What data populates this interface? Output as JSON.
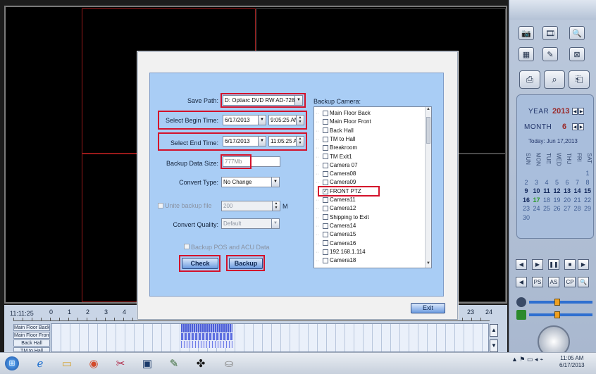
{
  "timeline": {
    "current_time": "11:11:25",
    "ticks_left": [
      "0",
      "1",
      "2",
      "3",
      "4"
    ],
    "ticks_right": [
      "23",
      "24"
    ],
    "channels": [
      "Main Floor Back",
      "Main Floor Front",
      "Back Hall",
      "TM to Hall"
    ]
  },
  "calendar": {
    "year_label": "YEAR",
    "year": "2013",
    "month_label": "MONTH",
    "month": "6",
    "today": "Today: Jun 17,2013",
    "day_names": [
      "SUN",
      "MON",
      "TUE",
      "WED",
      "THU",
      "FRI",
      "SAT"
    ],
    "days": [
      [
        "",
        "",
        "",
        "",
        "",
        "",
        "1"
      ],
      [
        "2",
        "3",
        "4",
        "5",
        "6",
        "7",
        "8"
      ],
      [
        "9",
        "10",
        "11",
        "12",
        "13",
        "14",
        "15"
      ],
      [
        "16",
        "17",
        "18",
        "19",
        "20",
        "21",
        "22"
      ],
      [
        "23",
        "24",
        "25",
        "26",
        "27",
        "28",
        "29"
      ],
      [
        "30",
        "",
        "",
        "",
        "",
        "",
        ""
      ]
    ]
  },
  "controls": {
    "row2_labels": [
      "PS",
      "AS",
      "CP"
    ]
  },
  "dialog": {
    "save_path_label": "Save Path:",
    "save_path_value": "D: Optiarc DVD RW AD-728",
    "begin_label": "Select Begin Time:",
    "begin_date": "6/17/2013",
    "begin_time": "9:05:25 AM",
    "end_label": "Select End Time:",
    "end_date": "6/17/2013",
    "end_time": "11:05:25 AM",
    "size_label": "Backup Data Size:",
    "size_value": "777Mb",
    "convert_type_label": "Convert Type:",
    "convert_type_value": "No Change",
    "unite_label": "Unite backup file",
    "unite_value": "200",
    "unite_unit": "M",
    "convert_quality_label": "Convert Quality:",
    "convert_quality_value": "Default",
    "pos_label": "Backup POS and ACU Data",
    "check_button": "Check",
    "backup_button": "Backup",
    "exit_button": "Exit",
    "camera_label": "Backup Camera:",
    "cameras": [
      {
        "name": "Main Floor Back",
        "checked": false
      },
      {
        "name": "Main Floor Front",
        "checked": false
      },
      {
        "name": "Back Hall",
        "checked": false
      },
      {
        "name": "TM to Hall",
        "checked": false
      },
      {
        "name": "Breakroom",
        "checked": false
      },
      {
        "name": "TM Exit1",
        "checked": false
      },
      {
        "name": "Camera 07",
        "checked": false
      },
      {
        "name": "Camera08",
        "checked": false
      },
      {
        "name": "Camera09",
        "checked": false
      },
      {
        "name": "FRONT PTZ",
        "checked": true
      },
      {
        "name": "Camera11",
        "checked": false
      },
      {
        "name": "Camera12",
        "checked": false
      },
      {
        "name": "Shipping to Exit",
        "checked": false
      },
      {
        "name": "Camera14",
        "checked": false
      },
      {
        "name": "Camera15",
        "checked": false
      },
      {
        "name": "Camera16",
        "checked": false
      },
      {
        "name": "192.168.1.114",
        "checked": false
      },
      {
        "name": "Camera18",
        "checked": false
      }
    ]
  },
  "taskbar": {
    "time": "11:05 AM",
    "date": "6/17/2013"
  },
  "colors": {
    "highlight_red": "#d4122b",
    "panel_blue": "#a9cdf5",
    "today_green": "#2b9a2b"
  }
}
